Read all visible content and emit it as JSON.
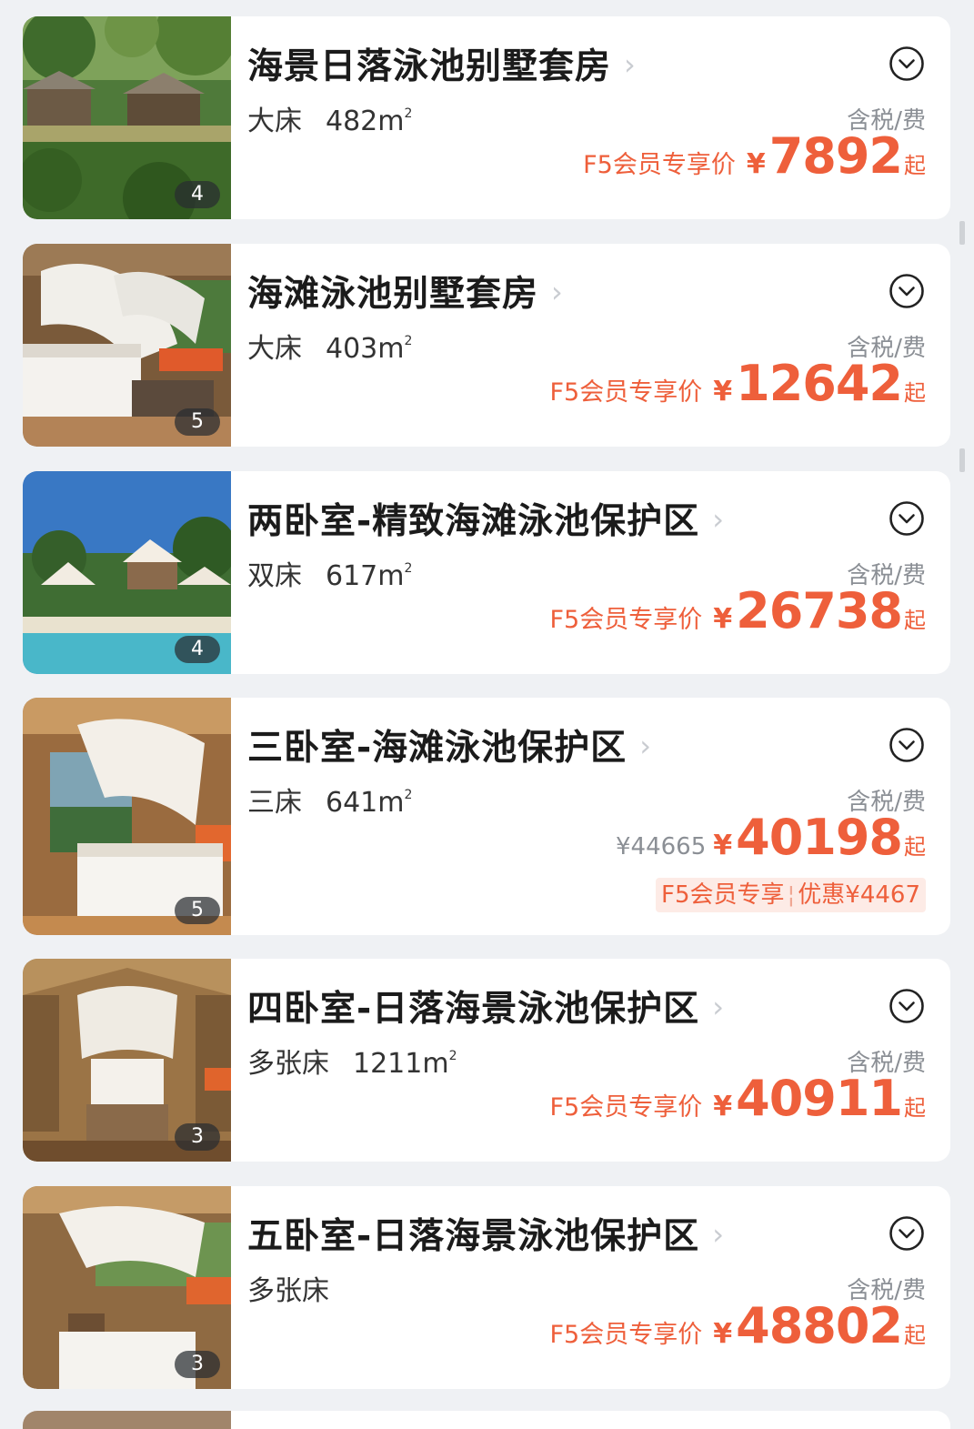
{
  "rooms": [
    {
      "name": "海景日落泳池别墅套房",
      "bed": "大床",
      "area": "482m",
      "area_unit_sup": "2",
      "photo_count": "4",
      "tax_note": "含税/费",
      "member_label": "F5会员专享价",
      "currency": "¥",
      "price": "7892",
      "suffix": "起",
      "scene": "villa"
    },
    {
      "name": "海滩泳池别墅套房",
      "bed": "大床",
      "area": "403m",
      "area_unit_sup": "2",
      "photo_count": "5",
      "tax_note": "含税/费",
      "member_label": "F5会员专享价",
      "currency": "¥",
      "price": "12642",
      "suffix": "起",
      "scene": "bedroom"
    },
    {
      "name": "两卧室-精致海滩泳池保护区",
      "bed": "双床",
      "area": "617m",
      "area_unit_sup": "2",
      "photo_count": "4",
      "tax_note": "含税/费",
      "member_label": "F5会员专享价",
      "currency": "¥",
      "price": "26738",
      "suffix": "起",
      "scene": "beach"
    },
    {
      "name": "三卧室-海滩泳池保护区",
      "bed": "三床",
      "area": "641m",
      "area_unit_sup": "2",
      "photo_count": "5",
      "tax_note": "含税/费",
      "original_price": "¥44665",
      "currency": "¥",
      "price": "40198",
      "suffix": "起",
      "discount_label": "F5会员专享",
      "discount_sep": "¦",
      "discount_amount": "优惠¥4467",
      "scene": "bedroom-view"
    },
    {
      "name": "四卧室-日落海景泳池保护区",
      "bed": "多张床",
      "area": "1211m",
      "area_unit_sup": "2",
      "photo_count": "3",
      "tax_note": "含税/费",
      "member_label": "F5会员专享价",
      "currency": "¥",
      "price": "40911",
      "suffix": "起",
      "scene": "bedroom-wood"
    },
    {
      "name": "五卧室-日落海景泳池保护区",
      "bed": "多张床",
      "area": "",
      "area_unit_sup": "",
      "photo_count": "3",
      "tax_note": "含税/费",
      "member_label": "F5会员专享价",
      "currency": "¥",
      "price": "48802",
      "suffix": "起",
      "scene": "bedroom-garden"
    }
  ],
  "icons": {
    "expand": "chevron-down-circle-icon",
    "name_arrow": "chevron-right-icon"
  },
  "colors": {
    "accent": "#ee5f3b",
    "background": "#eff1f4",
    "card": "#ffffff",
    "muted": "#8b8f95"
  }
}
